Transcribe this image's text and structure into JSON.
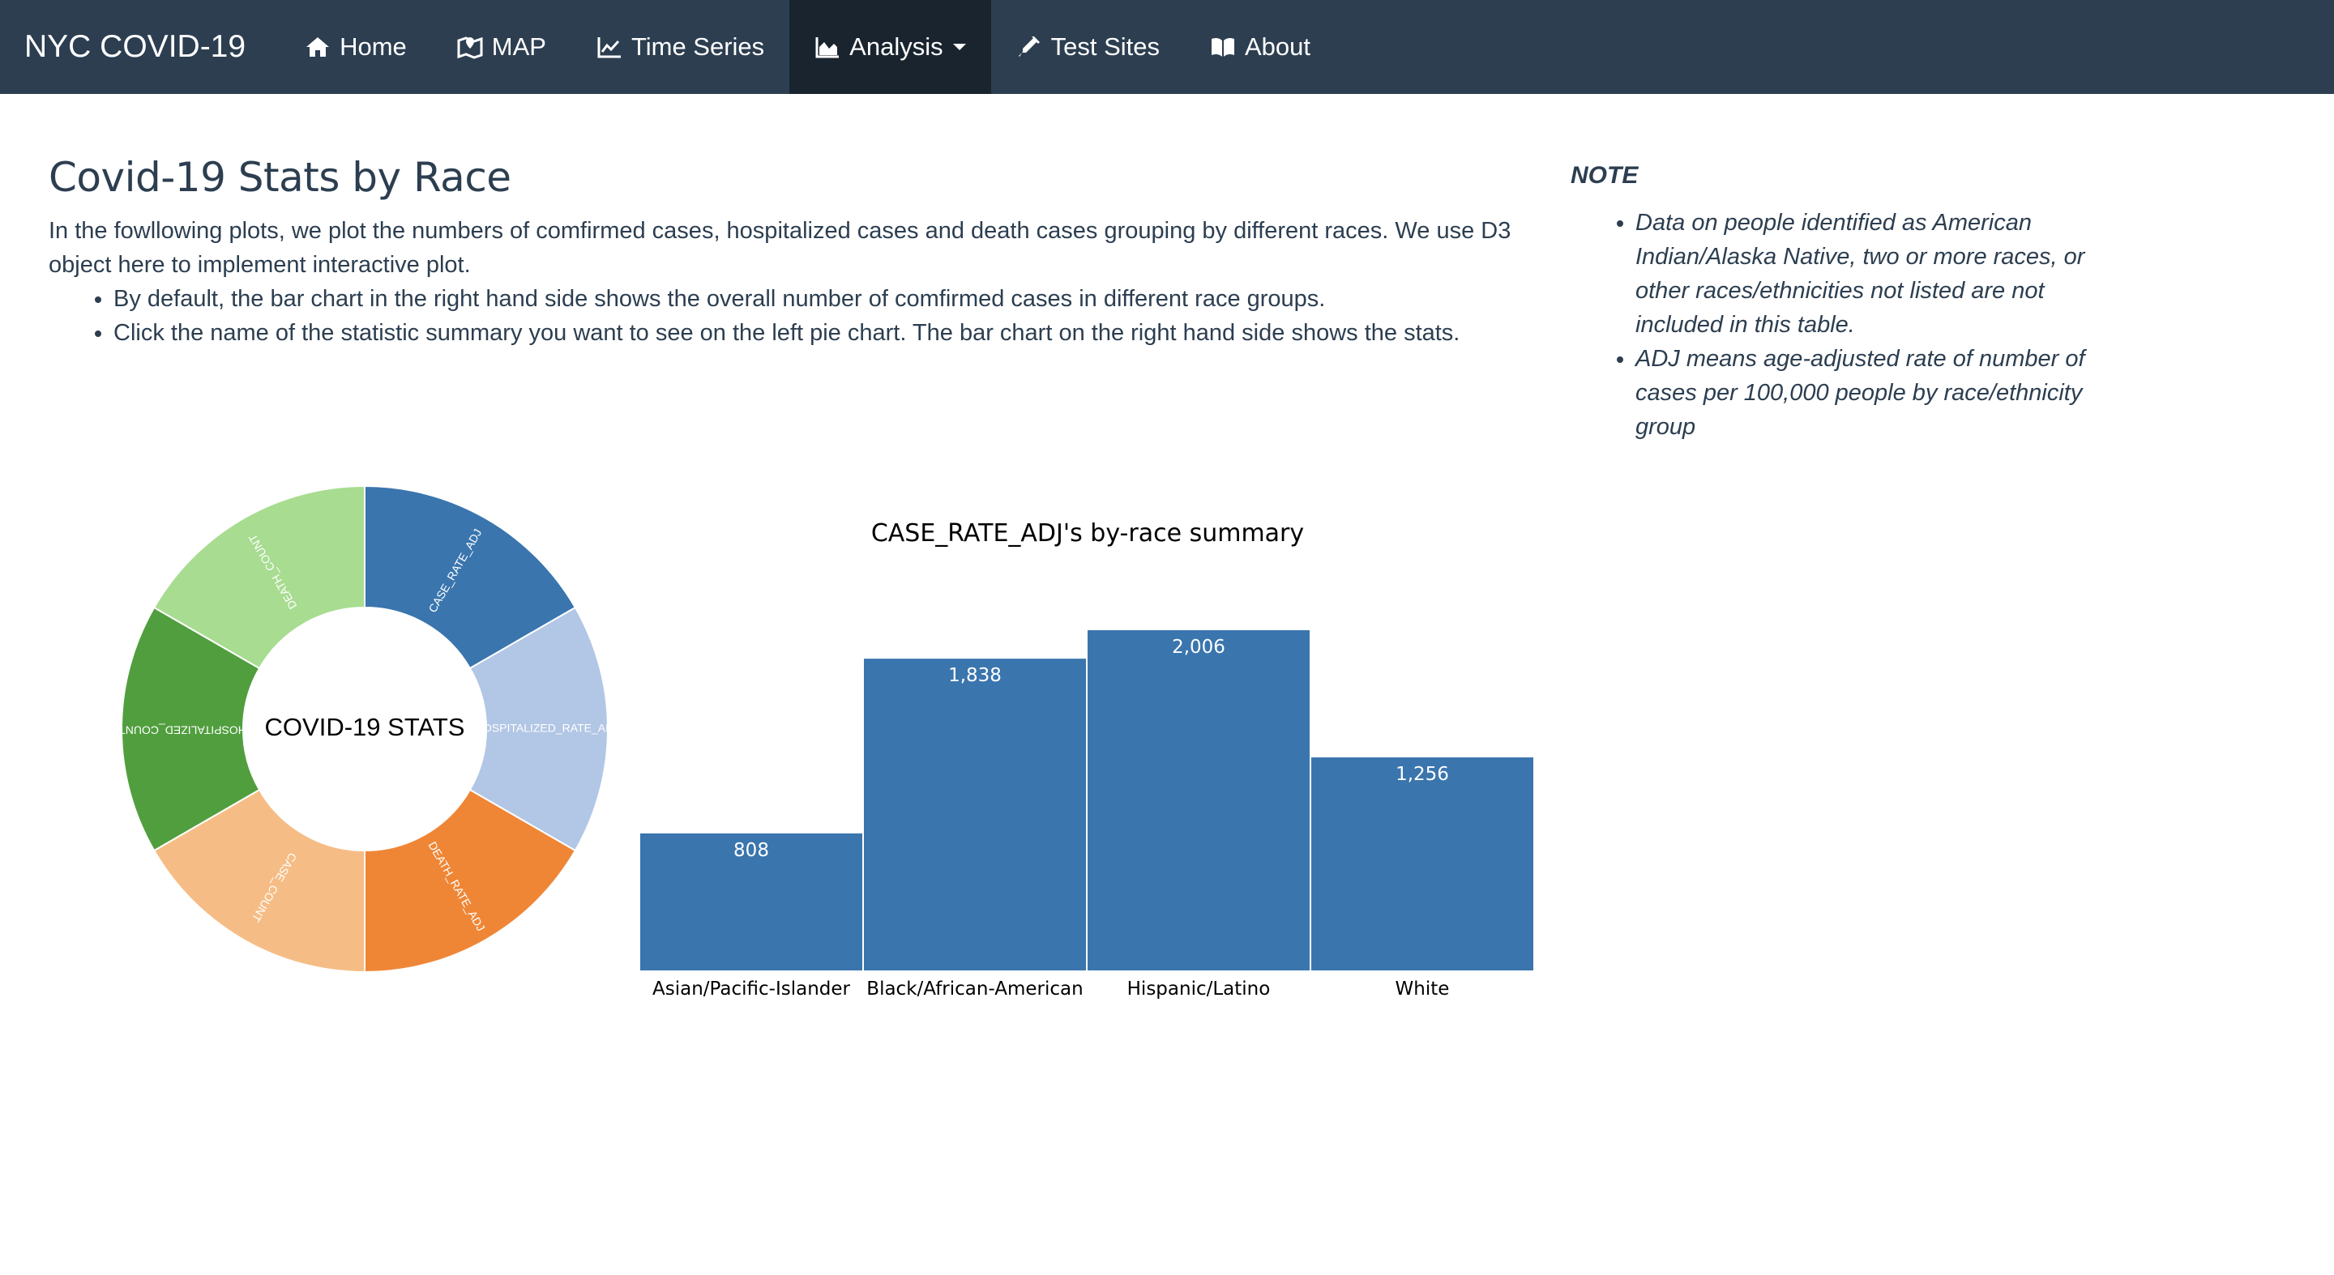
{
  "navbar": {
    "brand": "NYC COVID-19",
    "items": [
      {
        "label": "Home",
        "icon": "home-icon"
      },
      {
        "label": "MAP",
        "icon": "map-icon"
      },
      {
        "label": "Time Series",
        "icon": "line-chart-icon"
      },
      {
        "label": "Analysis",
        "icon": "area-chart-icon",
        "active": true,
        "dropdown": true
      },
      {
        "label": "Test Sites",
        "icon": "syringe-icon"
      },
      {
        "label": "About",
        "icon": "book-icon"
      }
    ]
  },
  "intro": {
    "title": "Covid-19 Stats by Race",
    "paragraph": "In the fowllowing plots, we plot the numbers of comfirmed cases, hospitalized cases and death cases grouping by different races. We use D3 object here to implement interactive plot.",
    "bullets": [
      "By default, the bar chart in the right hand side shows the overall number of comfirmed cases in different race groups.",
      "Click the name of the statistic summary you want to see on the left pie chart. The bar chart on the right hand side shows the stats."
    ]
  },
  "note": {
    "title": "NOTE",
    "bullets": [
      "Data on people identified as American Indian/Alaska Native, two or more races, or other races/ethnicities not listed are not included in this table.",
      "ADJ means age-adjusted rate of number of cases per 100,000 people by race/ethnicity group"
    ]
  },
  "chart_data": [
    {
      "type": "pie",
      "center_label": "COVID-19 STATS",
      "slices": [
        {
          "label": "CASE_RATE_ADJ",
          "value": 1,
          "color": "#3a75ae"
        },
        {
          "label": "HOSPITALIZED_RATE_ADJ",
          "value": 1,
          "color": "#b2c6e5"
        },
        {
          "label": "DEATH_RATE_ADJ",
          "value": 1,
          "color": "#ef8636"
        },
        {
          "label": "CASE_COUNT",
          "value": 1,
          "color": "#f5bd85"
        },
        {
          "label": "HOSPITALIZED_COUNT",
          "value": 1,
          "color": "#519e3e"
        },
        {
          "label": "DEATH_COUNT",
          "value": 1,
          "color": "#a8dc91"
        }
      ]
    },
    {
      "type": "bar",
      "title": "CASE_RATE_ADJ's by-race summary",
      "categories": [
        "Asian/Pacific-Islander",
        "Black/African-American",
        "Hispanic/Latino",
        "White"
      ],
      "values": [
        808,
        1838,
        2006,
        1256
      ],
      "value_labels": [
        "808",
        "1,838",
        "2,006",
        "1,256"
      ],
      "ylim": [
        0,
        2006
      ],
      "color": "#3a75ae"
    }
  ]
}
